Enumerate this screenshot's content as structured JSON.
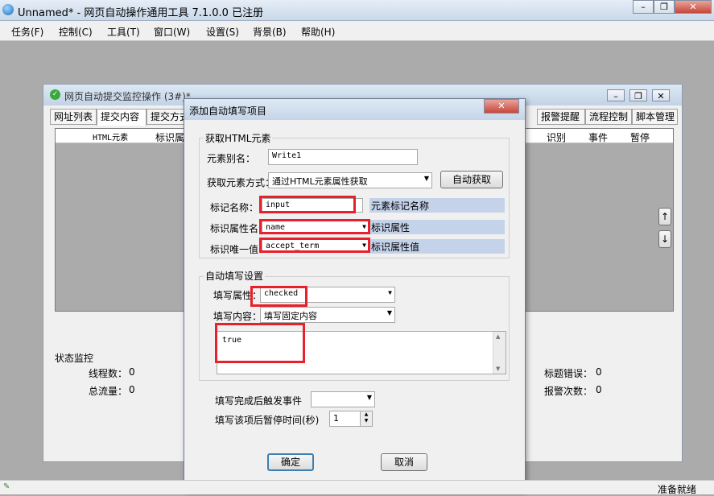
{
  "app": {
    "title": "Unnamed* - 网页自动操作通用工具 7.1.0.0  已注册",
    "status_text": "准备就绪"
  },
  "menu": [
    "任务(F)",
    "控制(C)",
    "工具(T)",
    "窗口(W)",
    "设置(S)",
    "背景(B)",
    "帮助(H)"
  ],
  "child_window": {
    "title": "网页自动提交监控操作 (3#)*",
    "tabs": [
      "网址列表",
      "提交内容",
      "提交方式",
      "报警提醒",
      "流程控制",
      "脚本管理"
    ],
    "grid_columns": [
      "HTML元素",
      "标识属",
      "识别",
      "事件",
      "暂停"
    ],
    "status_monitor": {
      "title": "状态监控",
      "thread_label": "线程数：",
      "thread_value": "0",
      "traffic_label": "总流量：",
      "traffic_value": "0",
      "title_error_label": "标题错误：",
      "title_error_value": "0",
      "alarm_label": "报警次数：",
      "alarm_value": "0"
    },
    "arrow_up": "↑",
    "arrow_down": "↓"
  },
  "dialog": {
    "title": "添加自动填写项目",
    "group_get": "获取HTML元素",
    "alias_label": "元素别名：",
    "alias_value": "Write1",
    "method_label": "获取元素方式：",
    "method_value": "通过HTML元素属性获取",
    "auto_get_button": "自动获取",
    "tag_label": "标记名称：",
    "tag_value": "input",
    "tag_hint": "元素标记名称",
    "attr_label": "标识属性名：",
    "attr_value": "name",
    "attr_hint": "标识属性",
    "unique_label": "标识唯一值：",
    "unique_value": "accept_term",
    "unique_hint": "标识属性值",
    "group_fill": "自动填写设置",
    "fill_attr_label": "填写属性：",
    "fill_attr_value": "checked",
    "fill_content_label": "填写内容：",
    "fill_content_value": "填写固定内容",
    "content_text": "true",
    "trigger_label": "填写完成后触发事件",
    "trigger_value": "",
    "pause_label": "填写该项后暂停时间(秒)",
    "pause_value": "1",
    "ok_button": "确定",
    "cancel_button": "取消"
  }
}
